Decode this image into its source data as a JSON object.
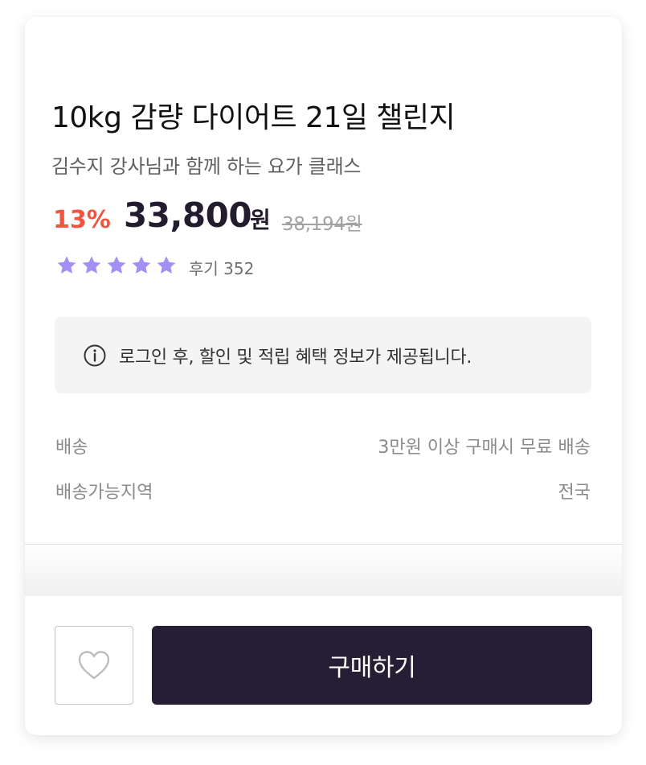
{
  "product": {
    "title": "10kg 감량 다이어트 21일 챌린지",
    "subtitle": "김수지 강사님과 함께 하는 요가 클래스",
    "discount": "13%",
    "price": "33,800",
    "currency": "원",
    "original_price": "38,194원",
    "rating_value": 5,
    "rating_max": 5,
    "review_label": "후기 352"
  },
  "notice": {
    "icon": "info-circle-icon",
    "text": "로그인 후, 할인 및 적립 혜택 정보가 제공됩니다."
  },
  "shipping": [
    {
      "label": "배송",
      "value": "3만원 이상 구매시 무료 배송"
    },
    {
      "label": "배송가능지역",
      "value": "전국"
    }
  ],
  "actions": {
    "wishlist_icon": "heart-outline-icon",
    "buy_label": "구매하기"
  },
  "colors": {
    "discount": "#f2553f",
    "price": "#221c2e",
    "star": "#a48ff5",
    "buy_button": "#261e34"
  }
}
